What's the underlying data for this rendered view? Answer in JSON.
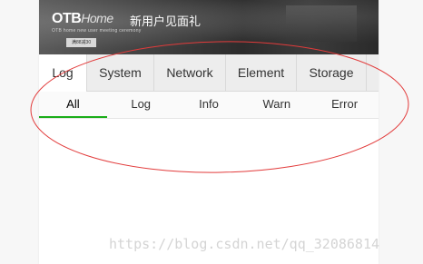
{
  "banner": {
    "logo": "OTB",
    "logo_suffix": "Home",
    "promo": "新用户见面礼",
    "sub": "OTB home new user meeting ceremony",
    "badge": "满88减30"
  },
  "tabs": [
    {
      "label": "Log",
      "active": true
    },
    {
      "label": "System",
      "active": false
    },
    {
      "label": "Network",
      "active": false
    },
    {
      "label": "Element",
      "active": false
    },
    {
      "label": "Storage",
      "active": false
    }
  ],
  "subtabs": [
    {
      "label": "All",
      "active": true
    },
    {
      "label": "Log",
      "active": false
    },
    {
      "label": "Info",
      "active": false
    },
    {
      "label": "Warn",
      "active": false
    },
    {
      "label": "Error",
      "active": false
    }
  ],
  "watermark": "https://blog.csdn.net/qq_32086814",
  "colors": {
    "active_underline": "#1aad19",
    "annotation": "#e23b3b",
    "tab_bar": "#ededed"
  }
}
